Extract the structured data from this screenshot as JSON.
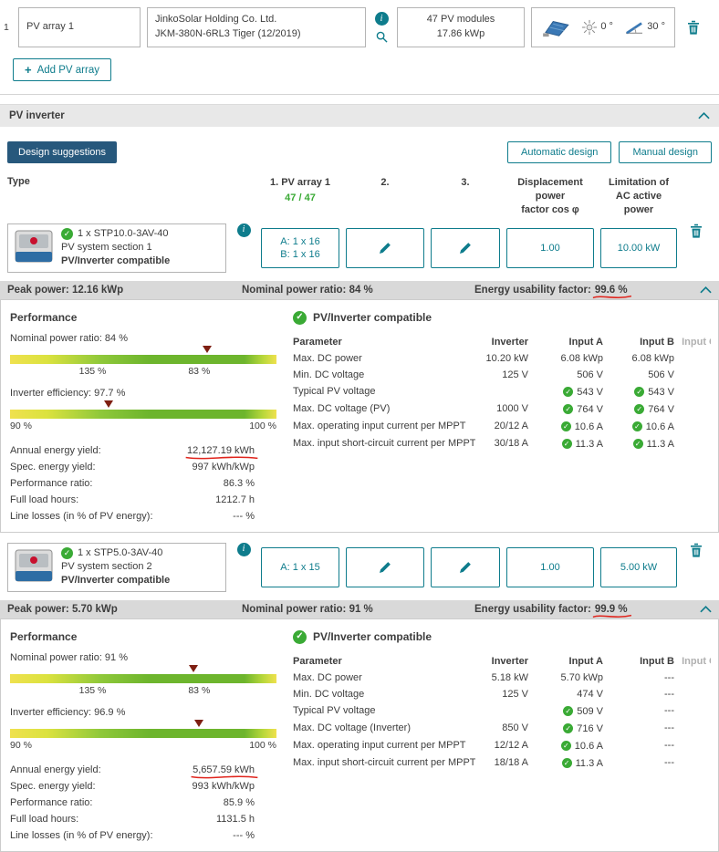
{
  "icons": {
    "check": "✓",
    "info": "i",
    "plus": "+"
  },
  "pv_array": {
    "index": "1",
    "name": "PV array 1",
    "module_manufacturer": "JinkoSolar Holding Co. Ltd.",
    "module_model": "JKM-380N-6RL3 Tiger (12/2019)",
    "module_count": "47 PV modules",
    "peak_power": "17.86 kWp",
    "azimuth": "0 °",
    "tilt": "30 °"
  },
  "add_pv_array_label": "Add PV array",
  "section_title": "PV inverter",
  "actions": {
    "design_suggestions": "Design suggestions",
    "automatic_design": "Automatic design",
    "manual_design": "Manual design"
  },
  "columns": {
    "type": "Type",
    "array1_title": "1. PV array 1",
    "array1_count": "47 / 47",
    "col2": "2.",
    "col3": "3.",
    "cos_phi_line1": "Displacement power",
    "cos_phi_line2": "factor cos φ",
    "ac_limit_line1": "Limitation of AC active",
    "ac_limit_line2": "power"
  },
  "inverters": [
    {
      "title": "1 x STP10.0-3AV-40",
      "subtitle": "PV system section 1",
      "status": "PV/Inverter compatible",
      "config_line1": "A: 1 x 16",
      "config_line2": "B: 1 x 16",
      "cos_phi": "1.00",
      "ac_limit": "10.00 kW",
      "summary": {
        "peak_power": "Peak power: 12.16 kWp",
        "nominal_ratio": "Nominal power ratio: 84 %",
        "usability_label": "Energy usability factor:",
        "usability_value": "99.6 %"
      },
      "performance": {
        "title": "Performance",
        "bar1_label": "Nominal power ratio: 84 %",
        "bar1_tick1": "135 %",
        "bar1_tick2": "83 %",
        "bar1_marker_pct": 74,
        "bar2_label": "Inverter efficiency: 97.7 %",
        "bar2_tick1": "90 %",
        "bar2_tick2": "100 %",
        "bar2_marker_pct": 37,
        "rows": [
          {
            "label": "Annual energy yield:",
            "value": "12,127.19 kWh"
          },
          {
            "label": "Spec. energy yield:",
            "value": "997 kWh/kWp"
          },
          {
            "label": "Performance ratio:",
            "value": "86.3 %"
          },
          {
            "label": "Full load hours:",
            "value": "1212.7 h"
          },
          {
            "label": "Line losses (in % of PV energy):",
            "value": "--- %"
          }
        ]
      },
      "compat": {
        "title": "PV/Inverter compatible",
        "headers": [
          "Parameter",
          "Inverter",
          "Input A",
          "Input B",
          "Input C"
        ],
        "rows": [
          {
            "param": "Max. DC power",
            "inverter": "10.20 kW",
            "a": "6.08 kWp",
            "b": "6.08 kWp"
          },
          {
            "param": "Min. DC voltage",
            "inverter": "125 V",
            "a": "506 V",
            "b": "506 V"
          },
          {
            "param": "Typical PV voltage",
            "inverter": "",
            "a": "543 V",
            "b": "543 V"
          },
          {
            "param": "Max. DC voltage (PV)",
            "inverter": "1000 V",
            "a": "764 V",
            "b": "764 V"
          },
          {
            "param": "Max. operating input current per MPPT",
            "inverter": "20/12 A",
            "a": "10.6 A",
            "b": "10.6 A"
          },
          {
            "param": "Max. input short-circuit current per MPPT",
            "inverter": "30/18 A",
            "a": "11.3 A",
            "b": "11.3 A"
          }
        ]
      }
    },
    {
      "title": "1 x STP5.0-3AV-40",
      "subtitle": "PV system section 2",
      "status": "PV/Inverter compatible",
      "config_line1": "A: 1 x 15",
      "cos_phi": "1.00",
      "ac_limit": "5.00 kW",
      "summary": {
        "peak_power": "Peak power: 5.70 kWp",
        "nominal_ratio": "Nominal power ratio: 91 %",
        "usability_label": "Energy usability factor:",
        "usability_value": "99.9 %"
      },
      "performance": {
        "title": "Performance",
        "bar1_label": "Nominal power ratio: 91 %",
        "bar1_tick1": "135 %",
        "bar1_tick2": "83 %",
        "bar1_marker_pct": 69,
        "bar2_label": "Inverter efficiency: 96.9 %",
        "bar2_tick1": "90 %",
        "bar2_tick2": "100 %",
        "bar2_marker_pct": 71,
        "rows": [
          {
            "label": "Annual energy yield:",
            "value": "5,657.59 kWh"
          },
          {
            "label": "Spec. energy yield:",
            "value": "993 kWh/kWp"
          },
          {
            "label": "Performance ratio:",
            "value": "85.9 %"
          },
          {
            "label": "Full load hours:",
            "value": "1131.5 h"
          },
          {
            "label": "Line losses (in % of PV energy):",
            "value": "--- %"
          }
        ]
      },
      "compat": {
        "title": "PV/Inverter compatible",
        "headers": [
          "Parameter",
          "Inverter",
          "Input A",
          "Input B",
          "Input C"
        ],
        "rows": [
          {
            "param": "Max. DC power",
            "inverter": "5.18 kW",
            "a": "5.70 kWp",
            "b": "---"
          },
          {
            "param": "Min. DC voltage",
            "inverter": "125 V",
            "a": "474 V",
            "b": "---"
          },
          {
            "param": "Typical PV voltage",
            "inverter": "",
            "a": "509 V",
            "b": "---"
          },
          {
            "param": "Max. DC voltage (Inverter)",
            "inverter": "850 V",
            "a": "716 V",
            "b": "---"
          },
          {
            "param": "Max. operating input current per MPPT",
            "inverter": "12/12 A",
            "a": "10.6 A",
            "b": "---"
          },
          {
            "param": "Max. input short-circuit current per MPPT",
            "inverter": "18/18 A",
            "a": "11.3 A",
            "b": "---"
          }
        ]
      }
    }
  ],
  "colors": {
    "teal": "#0e7c8c",
    "navy": "#27587c",
    "green": "#3aaa35",
    "annotation_red": "#e0241c"
  }
}
